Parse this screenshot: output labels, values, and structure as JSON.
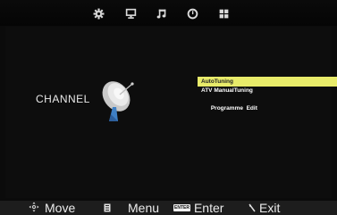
{
  "top_bar": {
    "icons": [
      "gear-icon",
      "monitor-icon",
      "music-note-icon",
      "clock-icon",
      "grid-icon"
    ]
  },
  "channel_page": {
    "title": "CHANNEL",
    "icon": "satellite-dish-icon"
  },
  "menu": {
    "items": [
      {
        "label": "AutoTuning",
        "selected": true
      },
      {
        "label": "ATV ManualTuning",
        "selected": false
      },
      {
        "label": "Programme  Edit",
        "selected": false
      }
    ],
    "highlight_color": "#E8EB6A"
  },
  "bottom_bar": {
    "move_label": "Move",
    "menu_label": "Menu",
    "enter_badge": "ENTER",
    "enter_label": "Enter",
    "exit_label": "Exit"
  }
}
